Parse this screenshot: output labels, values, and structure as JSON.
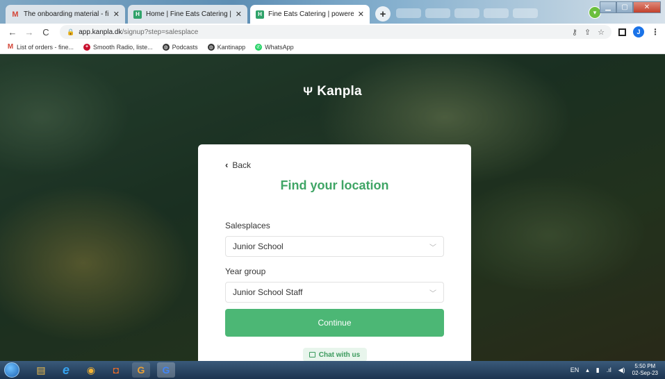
{
  "browser": {
    "tabs": [
      {
        "title": "The onboarding material - finee",
        "favicon": "gmail-icon",
        "active": false
      },
      {
        "title": "Home | Fine Eats Catering | powe",
        "favicon": "kanpla-icon",
        "active": false
      },
      {
        "title": "Fine Eats Catering | powered by",
        "favicon": "kanpla-icon",
        "active": true
      }
    ],
    "new_tab": "+",
    "address": {
      "host": "app.kanpla.dk",
      "path": "/signup?step=salesplace"
    },
    "profile_initial": "J",
    "bookmarks": [
      {
        "label": "List of orders - fine...",
        "icon": "gmail-icon"
      },
      {
        "label": "Smooth Radio, liste...",
        "icon": "uk-flag-icon"
      },
      {
        "label": "Podcasts",
        "icon": "globe-icon"
      },
      {
        "label": "Kantinapp",
        "icon": "globe-icon"
      },
      {
        "label": "WhatsApp",
        "icon": "whatsapp-icon"
      }
    ]
  },
  "page": {
    "brand": "Kanpla",
    "back_label": "Back",
    "title": "Find your location",
    "salesplaces_label": "Salesplaces",
    "salesplaces_value": "Junior School",
    "yeargroup_label": "Year group",
    "yeargroup_value": "Junior School Staff",
    "continue_label": "Continue",
    "chat_label": "Chat with us",
    "accent_color": "#4cb775"
  },
  "taskbar": {
    "language": "EN",
    "time": "5:50 PM",
    "date": "02-Sep-23"
  }
}
